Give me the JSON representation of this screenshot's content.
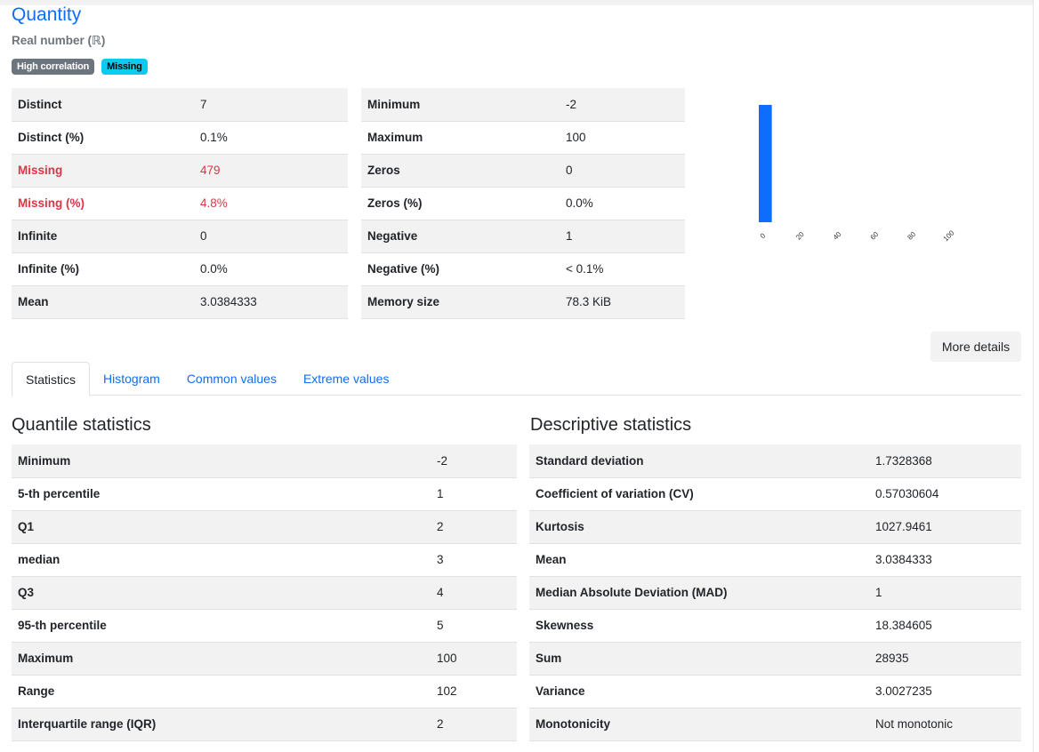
{
  "variable": {
    "name": "Quantity",
    "type": "Real number (ℝ)",
    "badges": [
      "High correlation",
      "Missing"
    ]
  },
  "overview_left": [
    {
      "label": "Distinct",
      "value": "7",
      "alert": false
    },
    {
      "label": "Distinct (%)",
      "value": "0.1%",
      "alert": false
    },
    {
      "label": "Missing",
      "value": "479",
      "alert": true
    },
    {
      "label": "Missing (%)",
      "value": "4.8%",
      "alert": true
    },
    {
      "label": "Infinite",
      "value": "0",
      "alert": false
    },
    {
      "label": "Infinite (%)",
      "value": "0.0%",
      "alert": false
    },
    {
      "label": "Mean",
      "value": "3.0384333",
      "alert": false
    }
  ],
  "overview_right": [
    {
      "label": "Minimum",
      "value": "-2"
    },
    {
      "label": "Maximum",
      "value": "100"
    },
    {
      "label": "Zeros",
      "value": "0"
    },
    {
      "label": "Zeros (%)",
      "value": "0.0%"
    },
    {
      "label": "Negative",
      "value": "1"
    },
    {
      "label": "Negative (%)",
      "value": "< 0.1%"
    },
    {
      "label": "Memory size",
      "value": "78.3 KiB"
    }
  ],
  "chart_data": {
    "type": "bar",
    "xlim": [
      -2,
      108
    ],
    "bins": [
      {
        "x0": -2,
        "x1": 5,
        "height": 1.0
      }
    ],
    "xticks": [
      "0",
      "20",
      "40",
      "60",
      "80",
      "100"
    ],
    "tick_values": [
      0,
      20,
      40,
      60,
      80,
      100
    ],
    "color": "#0d6efd"
  },
  "more_details_label": "More details",
  "tabs": [
    "Statistics",
    "Histogram",
    "Common values",
    "Extreme values"
  ],
  "active_tab": 0,
  "quantile": {
    "title": "Quantile statistics",
    "rows": [
      {
        "label": "Minimum",
        "value": "-2"
      },
      {
        "label": "5-th percentile",
        "value": "1"
      },
      {
        "label": "Q1",
        "value": "2"
      },
      {
        "label": "median",
        "value": "3"
      },
      {
        "label": "Q3",
        "value": "4"
      },
      {
        "label": "95-th percentile",
        "value": "5"
      },
      {
        "label": "Maximum",
        "value": "100"
      },
      {
        "label": "Range",
        "value": "102"
      },
      {
        "label": "Interquartile range (IQR)",
        "value": "2"
      }
    ]
  },
  "descriptive": {
    "title": "Descriptive statistics",
    "rows": [
      {
        "label": "Standard deviation",
        "value": "1.7328368"
      },
      {
        "label": "Coefficient of variation (CV)",
        "value": "0.57030604"
      },
      {
        "label": "Kurtosis",
        "value": "1027.9461"
      },
      {
        "label": "Mean",
        "value": "3.0384333"
      },
      {
        "label": "Median Absolute Deviation (MAD)",
        "value": "1"
      },
      {
        "label": "Skewness",
        "value": "18.384605"
      },
      {
        "label": "Sum",
        "value": "28935"
      },
      {
        "label": "Variance",
        "value": "3.0027235"
      },
      {
        "label": "Monotonicity",
        "value": "Not monotonic"
      }
    ]
  },
  "colors": {
    "accent": "#0d6efd",
    "alert": "#dc3545",
    "badge_dark": "#6c757d",
    "badge_info": "#0dcaf0"
  }
}
